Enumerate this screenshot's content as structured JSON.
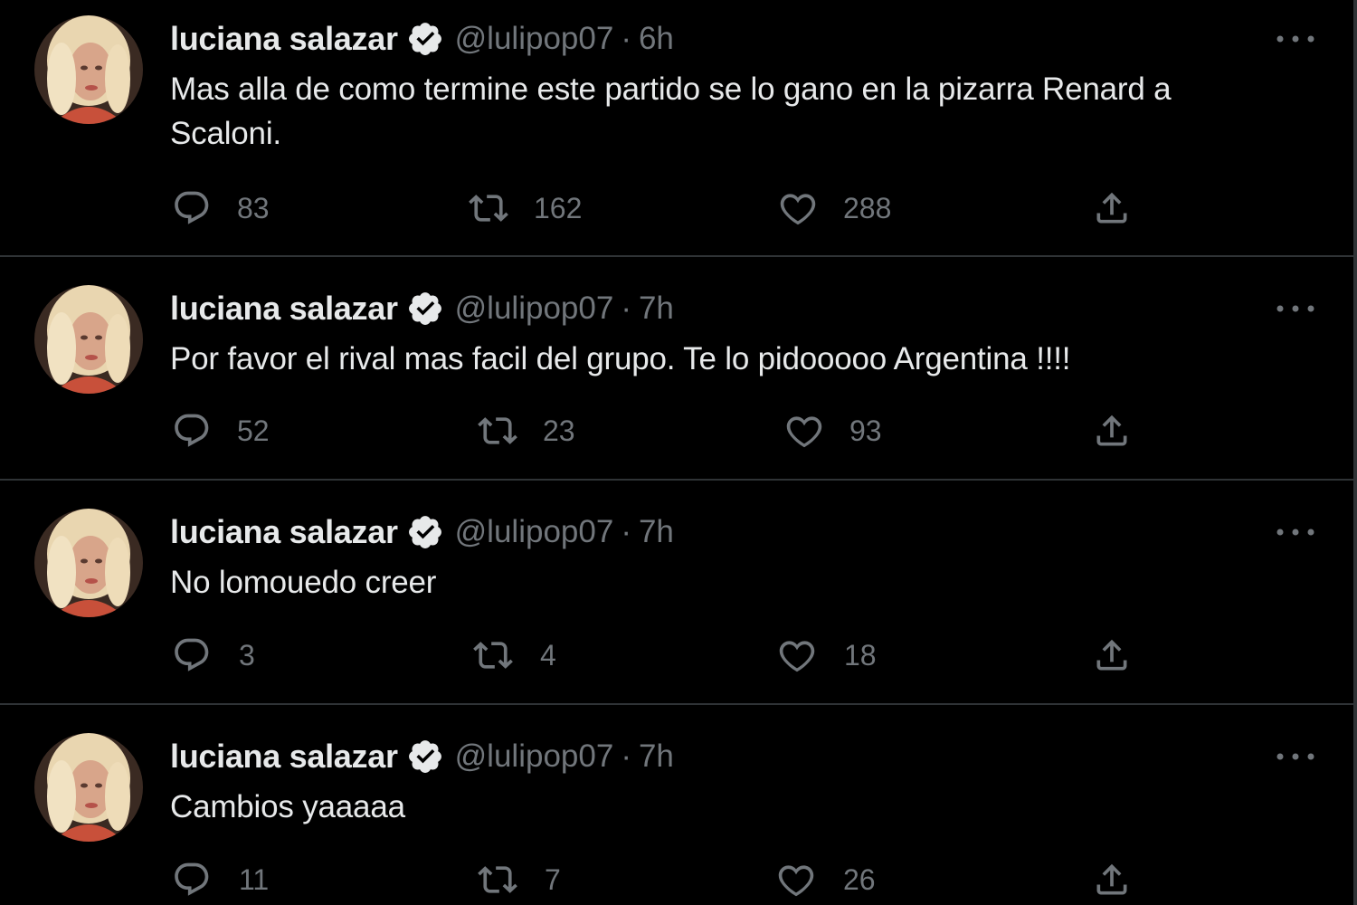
{
  "tweets": [
    {
      "author_name": "luciana salazar",
      "handle": "@lulipop07",
      "separator": "·",
      "time": "6h",
      "text": "Mas alla de como termine este partido se lo gano en la pizarra Renard a Scaloni.",
      "replies": "83",
      "retweets": "162",
      "likes": "288"
    },
    {
      "author_name": "luciana salazar",
      "handle": "@lulipop07",
      "separator": "·",
      "time": "7h",
      "text": "Por favor el rival mas facil del grupo. Te lo pidooooo Argentina !!!!",
      "replies": "52",
      "retweets": "23",
      "likes": "93"
    },
    {
      "author_name": "luciana salazar",
      "handle": "@lulipop07",
      "separator": "·",
      "time": "7h",
      "text": "No lomouedo creer",
      "replies": "3",
      "retweets": "4",
      "likes": "18"
    },
    {
      "author_name": "luciana salazar",
      "handle": "@lulipop07",
      "separator": "·",
      "time": "7h",
      "text": "Cambios yaaaaa",
      "replies": "11",
      "retweets": "7",
      "likes": "26"
    }
  ],
  "icons": {
    "reply": "reply-icon",
    "retweet": "retweet-icon",
    "like": "heart-icon",
    "share": "share-icon",
    "verified": "verified-badge-icon",
    "more": "more-options-icon"
  },
  "colors": {
    "background": "#000000",
    "primary_text": "#e7e9ea",
    "secondary_text": "#71767b",
    "divider": "#2f3336"
  }
}
